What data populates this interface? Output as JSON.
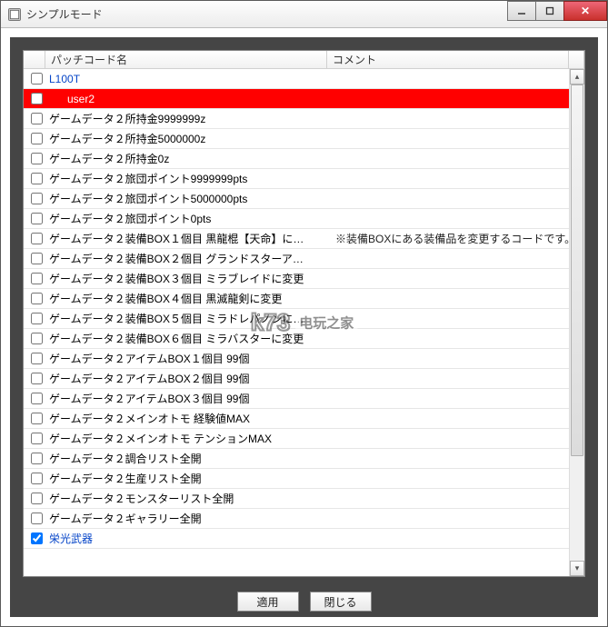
{
  "window": {
    "title": "シンプルモード"
  },
  "columns": {
    "name": "パッチコード名",
    "comment": "コメント"
  },
  "rows": [
    {
      "label": "L100T",
      "type": "group",
      "checked": false,
      "selected": false,
      "comment": ""
    },
    {
      "label": "user2",
      "type": "group-child",
      "checked": false,
      "selected": true,
      "comment": ""
    },
    {
      "label": "ゲームデータ２所持金9999999z",
      "type": "item",
      "checked": false,
      "selected": false,
      "comment": ""
    },
    {
      "label": "ゲームデータ２所持金5000000z",
      "type": "item",
      "checked": false,
      "selected": false,
      "comment": ""
    },
    {
      "label": "ゲームデータ２所持金0z",
      "type": "item",
      "checked": false,
      "selected": false,
      "comment": ""
    },
    {
      "label": "ゲームデータ２旅団ポイント9999999pts",
      "type": "item",
      "checked": false,
      "selected": false,
      "comment": ""
    },
    {
      "label": "ゲームデータ２旅団ポイント5000000pts",
      "type": "item",
      "checked": false,
      "selected": false,
      "comment": ""
    },
    {
      "label": "ゲームデータ２旅団ポイント0pts",
      "type": "item",
      "checked": false,
      "selected": false,
      "comment": ""
    },
    {
      "label": "ゲームデータ２装備BOX１個目 黒龍棍【天命】に…",
      "type": "item",
      "checked": false,
      "selected": false,
      "comment": "※装備BOXにある装備品を変更するコードです。"
    },
    {
      "label": "ゲームデータ２装備BOX２個目 グランドスターア…",
      "type": "item",
      "checked": false,
      "selected": false,
      "comment": ""
    },
    {
      "label": "ゲームデータ２装備BOX３個目 ミラブレイドに変更",
      "type": "item",
      "checked": false,
      "selected": false,
      "comment": ""
    },
    {
      "label": "ゲームデータ２装備BOX４個目 黒滅龍剣に変更",
      "type": "item",
      "checked": false,
      "selected": false,
      "comment": ""
    },
    {
      "label": "ゲームデータ２装備BOX５個目 ミラドレパノンに…",
      "type": "item",
      "checked": false,
      "selected": false,
      "comment": ""
    },
    {
      "label": "ゲームデータ２装備BOX６個目 ミラバスターに変更",
      "type": "item",
      "checked": false,
      "selected": false,
      "comment": ""
    },
    {
      "label": "ゲームデータ２アイテムBOX１個目 99個",
      "type": "item",
      "checked": false,
      "selected": false,
      "comment": ""
    },
    {
      "label": "ゲームデータ２アイテムBOX２個目 99個",
      "type": "item",
      "checked": false,
      "selected": false,
      "comment": ""
    },
    {
      "label": "ゲームデータ２アイテムBOX３個目 99個",
      "type": "item",
      "checked": false,
      "selected": false,
      "comment": ""
    },
    {
      "label": "ゲームデータ２メインオトモ 経験値MAX",
      "type": "item",
      "checked": false,
      "selected": false,
      "comment": ""
    },
    {
      "label": "ゲームデータ２メインオトモ テンションMAX",
      "type": "item",
      "checked": false,
      "selected": false,
      "comment": ""
    },
    {
      "label": "ゲームデータ２調合リスト全開",
      "type": "item",
      "checked": false,
      "selected": false,
      "comment": ""
    },
    {
      "label": "ゲームデータ２生産リスト全開",
      "type": "item",
      "checked": false,
      "selected": false,
      "comment": ""
    },
    {
      "label": "ゲームデータ２モンスターリスト全開",
      "type": "item",
      "checked": false,
      "selected": false,
      "comment": ""
    },
    {
      "label": "ゲームデータ２ギャラリー全開",
      "type": "item",
      "checked": false,
      "selected": false,
      "comment": ""
    },
    {
      "label": "栄光武器",
      "type": "group",
      "checked": true,
      "selected": false,
      "comment": ""
    }
  ],
  "buttons": {
    "apply": "適用",
    "close": "閉じる"
  },
  "watermark": {
    "brand": "k73",
    "tag": "电玩之家",
    "domain": ".com"
  }
}
